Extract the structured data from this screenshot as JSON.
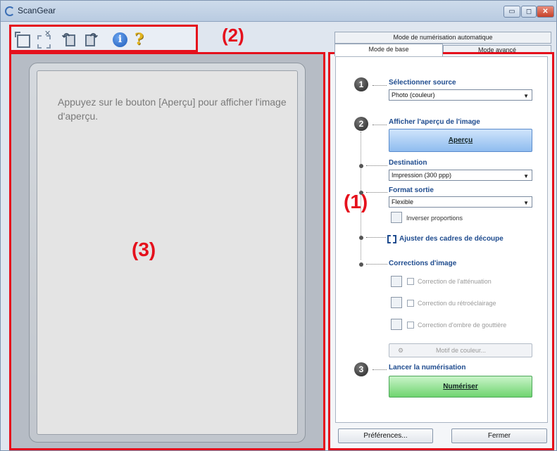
{
  "window": {
    "title": "ScanGear",
    "controls": {
      "minimize": "▭",
      "maximize": "◻",
      "close": "✕"
    }
  },
  "toolbar": {
    "icons": [
      "crop-icon",
      "clear-crop-icon",
      "rotate-left-icon",
      "rotate-right-icon",
      "info-icon",
      "help-icon"
    ],
    "info_glyph": "i",
    "help_glyph": "?"
  },
  "callouts": {
    "one": "(1)",
    "two": "(2)",
    "three": "(3)"
  },
  "preview": {
    "message": "Appuyez sur le bouton [Aperçu] pour afficher l'image d'aperçu."
  },
  "mode_tabs": {
    "auto": "Mode de numérisation automatique",
    "basic": "Mode de base",
    "advanced": "Mode avancé",
    "active": "basic"
  },
  "panel": {
    "step1": {
      "number": "1",
      "heading": "Sélectionner source",
      "source_value": "Photo (couleur)"
    },
    "step2": {
      "number": "2",
      "heading": "Afficher l'aperçu de l'image",
      "preview_button": "Aperçu",
      "destination_label": "Destination",
      "destination_value": "Impression (300 ppp)",
      "output_size_label": "Format sortie",
      "output_size_value": "Flexible",
      "invert_ratio": "Inverser proportions",
      "adjust_crop": "Ajuster des cadres de découpe",
      "corrections_label": "Corrections d'image",
      "corrections": [
        "Correction de l'atténuation",
        "Correction du rétroéclairage",
        "Correction d'ombre de gouttière"
      ],
      "color_pattern_button": "Motif de couleur..."
    },
    "step3": {
      "number": "3",
      "heading": "Lancer la numérisation",
      "scan_button": "Numériser"
    },
    "preferences_button": "Préférences...",
    "close_button": "Fermer",
    "caret": "▼"
  },
  "colors": {
    "callout_red": "#e5101c",
    "heading_blue": "#1e4b8e",
    "preview_button": "#8fbcef",
    "scan_button": "#6fd46f"
  }
}
